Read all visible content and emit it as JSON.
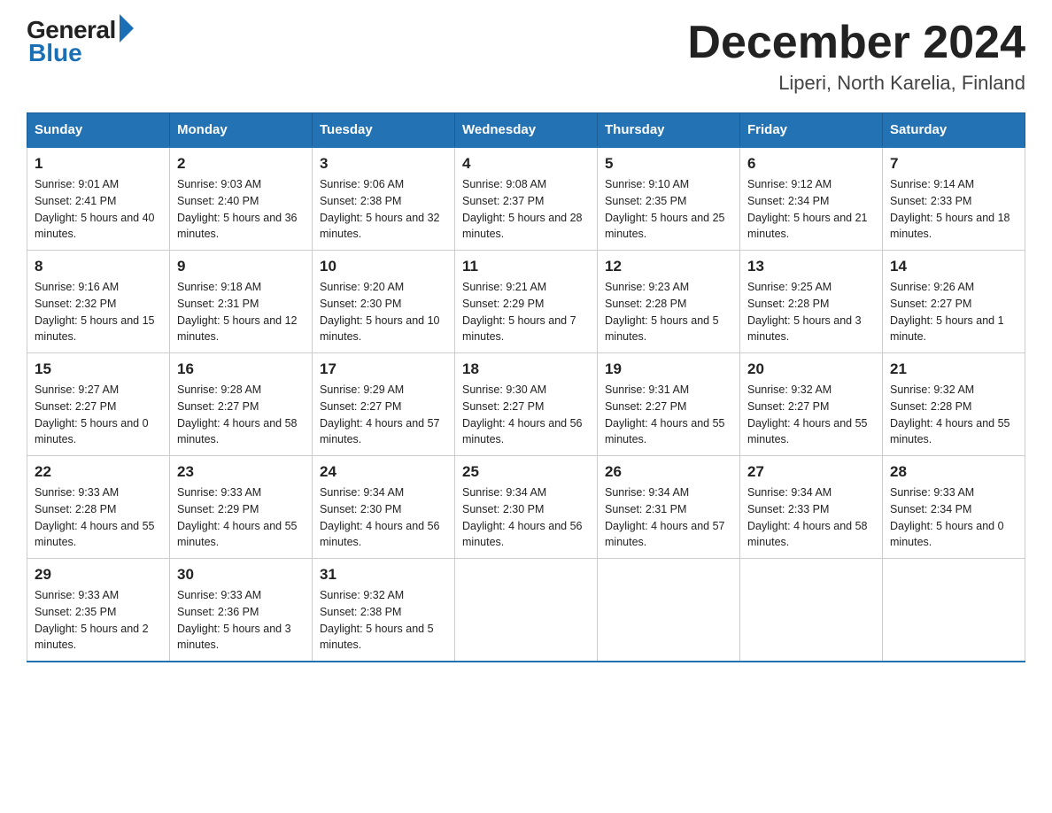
{
  "logo": {
    "general": "General",
    "blue": "Blue"
  },
  "title": "December 2024",
  "location": "Liperi, North Karelia, Finland",
  "days_of_week": [
    "Sunday",
    "Monday",
    "Tuesday",
    "Wednesday",
    "Thursday",
    "Friday",
    "Saturday"
  ],
  "weeks": [
    [
      {
        "day": "1",
        "sunrise": "9:01 AM",
        "sunset": "2:41 PM",
        "daylight": "5 hours and 40 minutes."
      },
      {
        "day": "2",
        "sunrise": "9:03 AM",
        "sunset": "2:40 PM",
        "daylight": "5 hours and 36 minutes."
      },
      {
        "day": "3",
        "sunrise": "9:06 AM",
        "sunset": "2:38 PM",
        "daylight": "5 hours and 32 minutes."
      },
      {
        "day": "4",
        "sunrise": "9:08 AM",
        "sunset": "2:37 PM",
        "daylight": "5 hours and 28 minutes."
      },
      {
        "day": "5",
        "sunrise": "9:10 AM",
        "sunset": "2:35 PM",
        "daylight": "5 hours and 25 minutes."
      },
      {
        "day": "6",
        "sunrise": "9:12 AM",
        "sunset": "2:34 PM",
        "daylight": "5 hours and 21 minutes."
      },
      {
        "day": "7",
        "sunrise": "9:14 AM",
        "sunset": "2:33 PM",
        "daylight": "5 hours and 18 minutes."
      }
    ],
    [
      {
        "day": "8",
        "sunrise": "9:16 AM",
        "sunset": "2:32 PM",
        "daylight": "5 hours and 15 minutes."
      },
      {
        "day": "9",
        "sunrise": "9:18 AM",
        "sunset": "2:31 PM",
        "daylight": "5 hours and 12 minutes."
      },
      {
        "day": "10",
        "sunrise": "9:20 AM",
        "sunset": "2:30 PM",
        "daylight": "5 hours and 10 minutes."
      },
      {
        "day": "11",
        "sunrise": "9:21 AM",
        "sunset": "2:29 PM",
        "daylight": "5 hours and 7 minutes."
      },
      {
        "day": "12",
        "sunrise": "9:23 AM",
        "sunset": "2:28 PM",
        "daylight": "5 hours and 5 minutes."
      },
      {
        "day": "13",
        "sunrise": "9:25 AM",
        "sunset": "2:28 PM",
        "daylight": "5 hours and 3 minutes."
      },
      {
        "day": "14",
        "sunrise": "9:26 AM",
        "sunset": "2:27 PM",
        "daylight": "5 hours and 1 minute."
      }
    ],
    [
      {
        "day": "15",
        "sunrise": "9:27 AM",
        "sunset": "2:27 PM",
        "daylight": "5 hours and 0 minutes."
      },
      {
        "day": "16",
        "sunrise": "9:28 AM",
        "sunset": "2:27 PM",
        "daylight": "4 hours and 58 minutes."
      },
      {
        "day": "17",
        "sunrise": "9:29 AM",
        "sunset": "2:27 PM",
        "daylight": "4 hours and 57 minutes."
      },
      {
        "day": "18",
        "sunrise": "9:30 AM",
        "sunset": "2:27 PM",
        "daylight": "4 hours and 56 minutes."
      },
      {
        "day": "19",
        "sunrise": "9:31 AM",
        "sunset": "2:27 PM",
        "daylight": "4 hours and 55 minutes."
      },
      {
        "day": "20",
        "sunrise": "9:32 AM",
        "sunset": "2:27 PM",
        "daylight": "4 hours and 55 minutes."
      },
      {
        "day": "21",
        "sunrise": "9:32 AM",
        "sunset": "2:28 PM",
        "daylight": "4 hours and 55 minutes."
      }
    ],
    [
      {
        "day": "22",
        "sunrise": "9:33 AM",
        "sunset": "2:28 PM",
        "daylight": "4 hours and 55 minutes."
      },
      {
        "day": "23",
        "sunrise": "9:33 AM",
        "sunset": "2:29 PM",
        "daylight": "4 hours and 55 minutes."
      },
      {
        "day": "24",
        "sunrise": "9:34 AM",
        "sunset": "2:30 PM",
        "daylight": "4 hours and 56 minutes."
      },
      {
        "day": "25",
        "sunrise": "9:34 AM",
        "sunset": "2:30 PM",
        "daylight": "4 hours and 56 minutes."
      },
      {
        "day": "26",
        "sunrise": "9:34 AM",
        "sunset": "2:31 PM",
        "daylight": "4 hours and 57 minutes."
      },
      {
        "day": "27",
        "sunrise": "9:34 AM",
        "sunset": "2:33 PM",
        "daylight": "4 hours and 58 minutes."
      },
      {
        "day": "28",
        "sunrise": "9:33 AM",
        "sunset": "2:34 PM",
        "daylight": "5 hours and 0 minutes."
      }
    ],
    [
      {
        "day": "29",
        "sunrise": "9:33 AM",
        "sunset": "2:35 PM",
        "daylight": "5 hours and 2 minutes."
      },
      {
        "day": "30",
        "sunrise": "9:33 AM",
        "sunset": "2:36 PM",
        "daylight": "5 hours and 3 minutes."
      },
      {
        "day": "31",
        "sunrise": "9:32 AM",
        "sunset": "2:38 PM",
        "daylight": "5 hours and 5 minutes."
      },
      null,
      null,
      null,
      null
    ]
  ]
}
